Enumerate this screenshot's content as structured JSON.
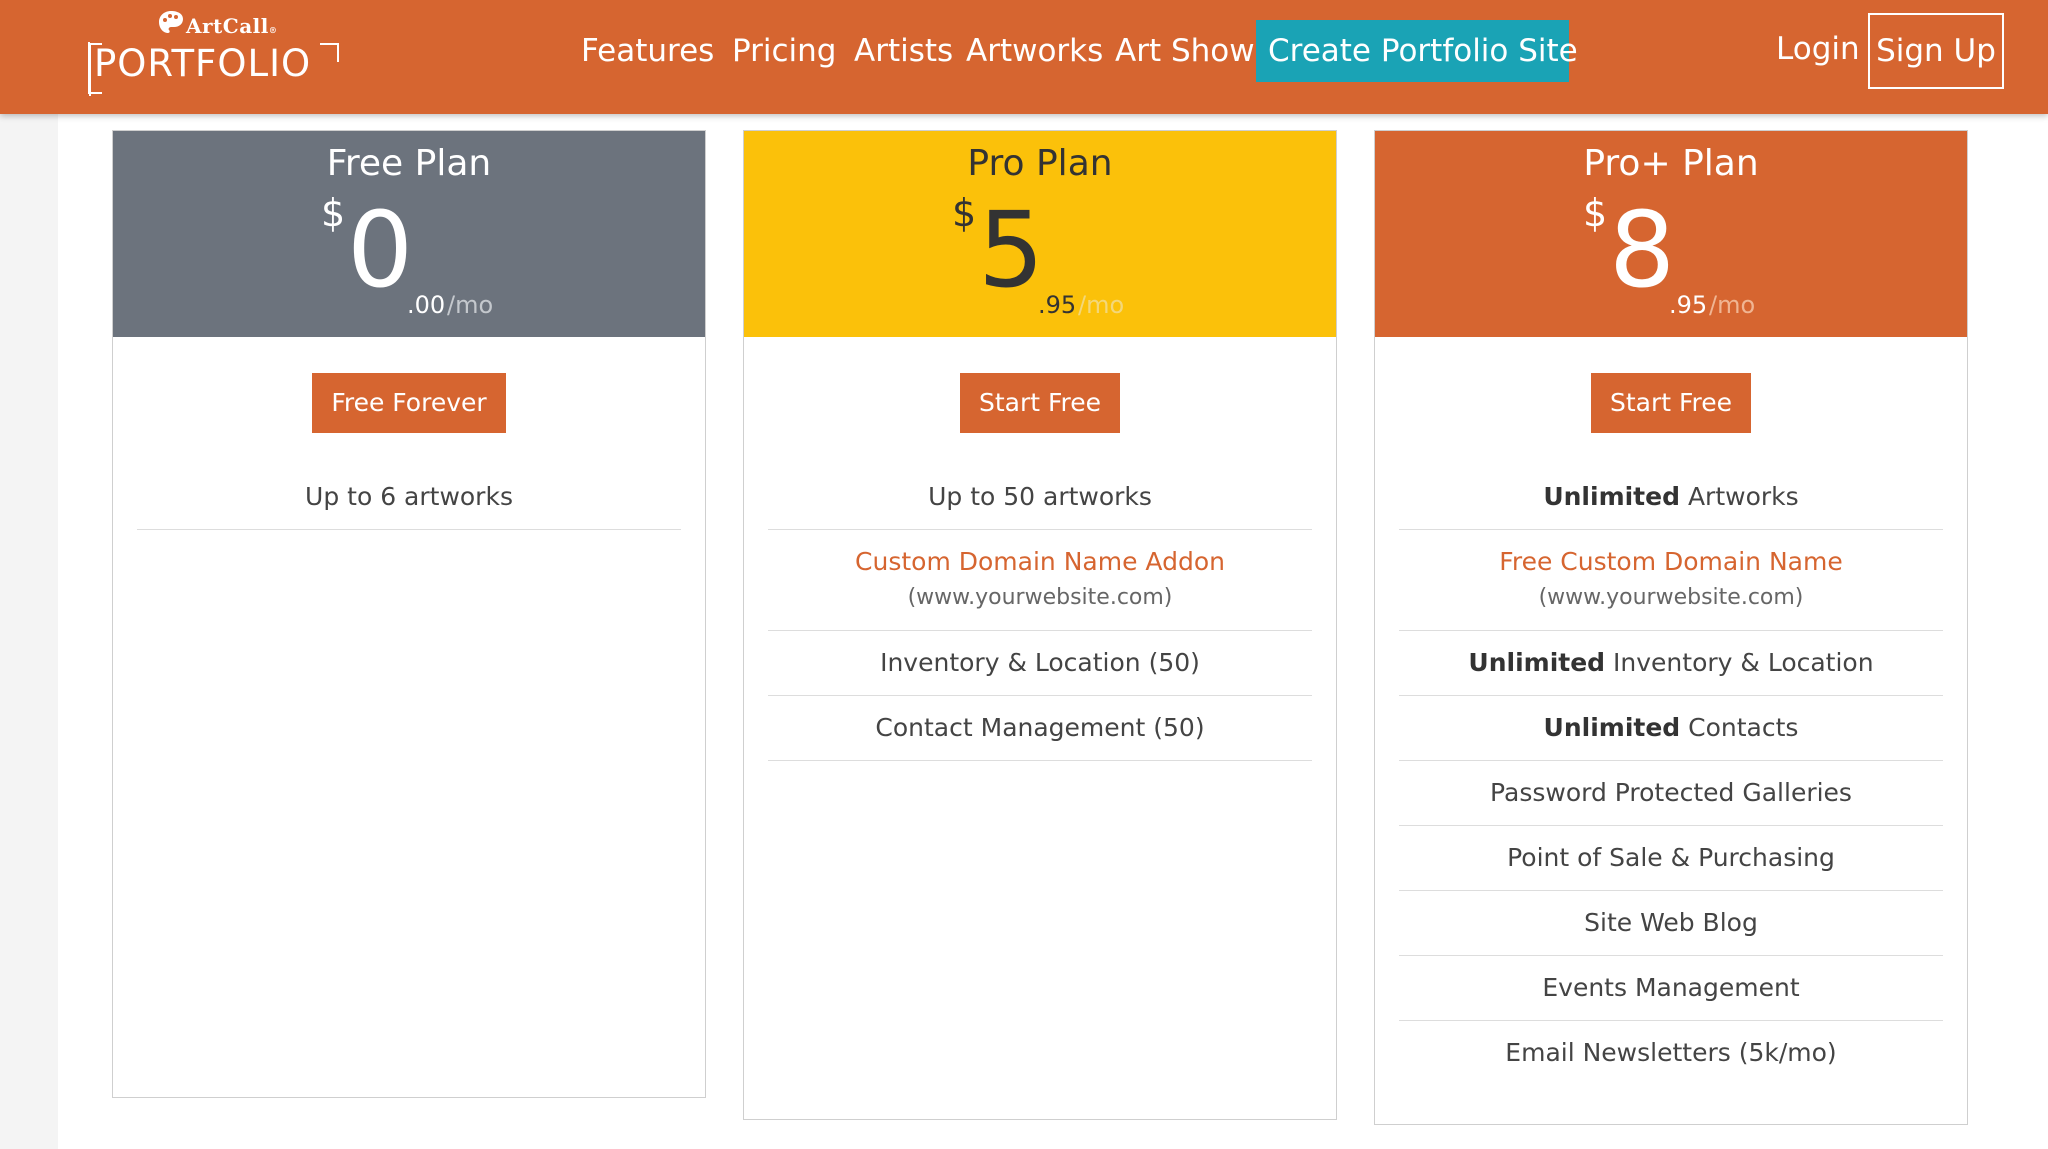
{
  "brand": {
    "top": "ArtCall",
    "reg": "®",
    "bottom": "PORTFOLIO"
  },
  "nav": {
    "items": [
      "Features",
      "Pricing",
      "Artists",
      "Artworks",
      "Art Show"
    ],
    "cta": "Create Portfolio Site",
    "login": "Login",
    "signup": "Sign Up"
  },
  "colors": {
    "brand": "#d66530",
    "cta": "#1aa3b5",
    "free": "#6c737d",
    "pro": "#fbc10a",
    "proplus": "#d66530"
  },
  "plans": [
    {
      "name": "Free Plan",
      "currency": "$",
      "dollars": "0",
      "cents": ".00",
      "per": "/mo",
      "button": "Free Forever",
      "features": [
        "Up to 6 artworks"
      ]
    },
    {
      "name": "Pro Plan",
      "currency": "$",
      "dollars": "5",
      "cents": ".95",
      "per": "/mo",
      "button": "Start Free",
      "features": [
        "Up to 50 artworks",
        {
          "accent": "Custom Domain Name Addon",
          "sub": "(www.yourwebsite.com)"
        },
        "Inventory & Location (50)",
        "Contact Management (50)"
      ]
    },
    {
      "name": "Pro+ Plan",
      "currency": "$",
      "dollars": "8",
      "cents": ".95",
      "per": "/mo",
      "button": "Start Free",
      "features": [
        {
          "bold": "Unlimited",
          "rest": " Artworks"
        },
        {
          "accent": "Free Custom Domain Name",
          "sub": "(www.yourwebsite.com)"
        },
        {
          "bold": "Unlimited",
          "rest": " Inventory & Location"
        },
        {
          "bold": "Unlimited",
          "rest": " Contacts"
        },
        "Password Protected Galleries",
        "Point of Sale & Purchasing",
        "Site Web Blog",
        "Events Management",
        "Email Newsletters (5k/mo)"
      ]
    }
  ]
}
